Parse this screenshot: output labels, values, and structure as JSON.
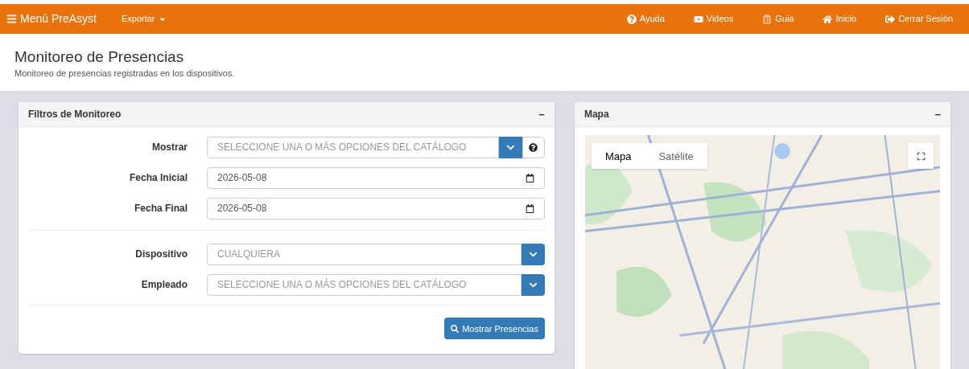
{
  "navbar": {
    "brand": "Menú PreAsyst",
    "menus": [
      {
        "label": "Exportar"
      }
    ],
    "links": [
      {
        "label": "Ayuda",
        "kind": "help"
      },
      {
        "label": "Videos",
        "kind": "video"
      },
      {
        "label": "Guia",
        "kind": "guide"
      },
      {
        "label": "Inicio",
        "kind": "home"
      },
      {
        "label": "Cerrar Sesión",
        "kind": "logout"
      }
    ]
  },
  "page": {
    "title": "Monitoreo de Presencias",
    "subtitle": "Monitoreo de presencias registradas en los dispositivos."
  },
  "filters": {
    "title": "Filtros de Monitoreo",
    "collapse": "−",
    "groups": [
      [
        {
          "label": "Mostrar",
          "kind": "multiselect",
          "placeholder": "SELECCIONE UNA O MÁS OPCIONES DEL CATÁLOGO",
          "help": true
        },
        {
          "label": "Fecha Inicial",
          "kind": "date",
          "value": "2026-05-08"
        },
        {
          "label": "Fecha Final",
          "kind": "date",
          "value": "2026-05-08"
        }
      ],
      [
        {
          "label": "Dispositivo",
          "kind": "select",
          "placeholder": "CUALQUIERA",
          "help": false
        },
        {
          "label": "Empleado",
          "kind": "multiselect",
          "placeholder": "SELECCIONE UNA O MÁS OPCIONES DEL CATÁLOGO",
          "help": false
        }
      ]
    ],
    "button": "Mostrar Presencias"
  },
  "map": {
    "title": "Mapa",
    "collapse": "−",
    "map_types": [
      {
        "label": "Mapa",
        "selected": true
      },
      {
        "label": "Satélite",
        "selected": false
      }
    ]
  }
}
